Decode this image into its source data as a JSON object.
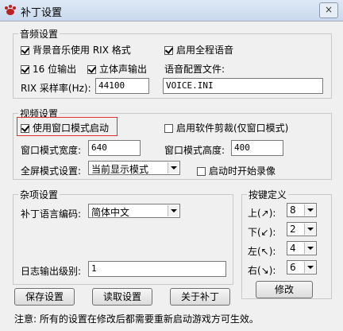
{
  "window": {
    "title": "补丁设置",
    "close_glyph": "×"
  },
  "audio": {
    "legend": "音频设置",
    "bg_music": {
      "label": "背景音乐使用 RIX 格式",
      "checked": true
    },
    "full_voice": {
      "label": "启用全程语音",
      "checked": true
    },
    "output16": {
      "label": "16 位输出",
      "checked": true
    },
    "stereo": {
      "label": "立体声输出",
      "checked": true
    },
    "voice_config_label": "语音配置文件:",
    "rix_rate_label": "RIX 采样率(Hz):",
    "rix_rate_value": "44100",
    "voice_file_value": "VOICE.INI"
  },
  "video": {
    "legend": "视频设置",
    "windowed_start": {
      "label": "使用窗口模式启动",
      "checked": true
    },
    "soft_clip": {
      "label": "启用软件剪裁(仅窗口模式)",
      "checked": false
    },
    "width_label": "窗口模式宽度:",
    "width_value": "640",
    "height_label": "窗口模式高度:",
    "height_value": "400",
    "fullscreen_label": "全屏模式设置:",
    "fullscreen_value": "当前显示模式",
    "record_on_start": {
      "label": "启动时开始录像",
      "checked": false
    }
  },
  "misc": {
    "legend": "杂项设置",
    "lang_label": "补丁语言编码:",
    "lang_value": "简体中文",
    "log_label": "日志输出级别:",
    "log_value": "1"
  },
  "keys": {
    "legend": "按键定义",
    "rows": [
      {
        "label": "上(↗):",
        "value": "8"
      },
      {
        "label": "下(↙):",
        "value": "2"
      },
      {
        "label": "左(↖):",
        "value": "4"
      },
      {
        "label": "右(↘):",
        "value": "6"
      }
    ],
    "modify_label": "修改"
  },
  "buttons": {
    "save": "保存设置",
    "load": "读取设置",
    "about": "关于补丁"
  },
  "footer": {
    "note": "注意: 所有的设置在修改后都需要重新启动游戏方可生效。"
  },
  "colors": {
    "highlight": "#e03030"
  },
  "icons": {
    "app": "paw-icon",
    "close": "close-icon"
  }
}
